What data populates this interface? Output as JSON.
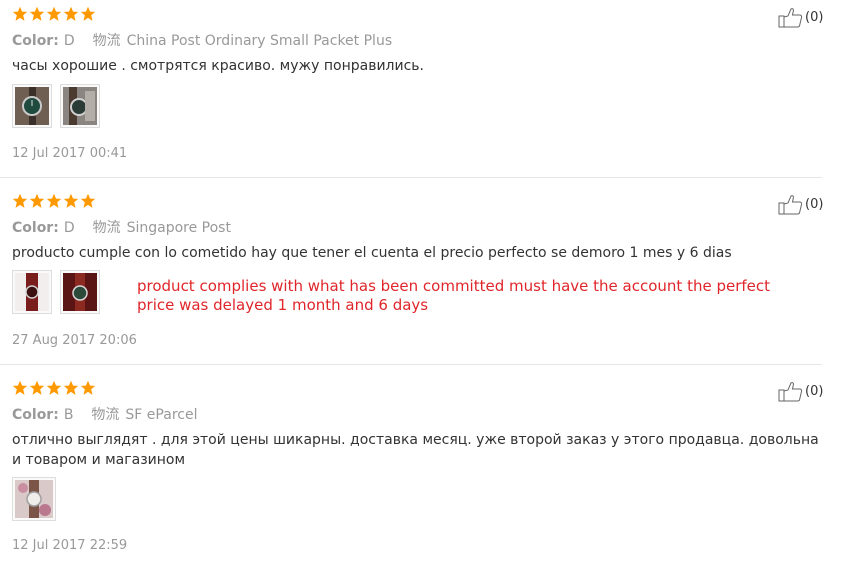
{
  "reviews": [
    {
      "rating": 5,
      "color_label": "Color:",
      "color_value": "D",
      "shipping_label": "物流",
      "shipping_value": "China Post Ordinary Small Packet Plus",
      "text": "часы хорошие . смотрятся красиво. мужу понравились.",
      "translation": "",
      "images": [
        "watch-photo",
        "watch-photo"
      ],
      "date": "12 Jul 2017 00:41",
      "likes": "(0)"
    },
    {
      "rating": 5,
      "color_label": "Color:",
      "color_value": "D",
      "shipping_label": "物流",
      "shipping_value": "Singapore Post",
      "text": "producto cumple con lo cometido hay que tener el cuenta el precio perfecto se demoro 1 mes y 6 dias",
      "translation": "product complies with what has been committed must have the account the perfect price was delayed 1 month and 6 days",
      "images": [
        "watch-photo",
        "watch-photo"
      ],
      "date": "27 Aug 2017 20:06",
      "likes": "(0)"
    },
    {
      "rating": 5,
      "color_label": "Color:",
      "color_value": "B",
      "shipping_label": "物流",
      "shipping_value": "SF eParcel",
      "text": "отлично выглядят . для этой цены шикарны. доставка месяц. уже второй заказ у этого продавца. довольна и товаром и магазином",
      "translation": "",
      "images": [
        "watch-photo"
      ],
      "date": "12 Jul 2017 22:59",
      "likes": "(0)"
    }
  ],
  "colors": {
    "star": "#ff9900",
    "translation": "#e0262a",
    "meta": "#999999"
  }
}
